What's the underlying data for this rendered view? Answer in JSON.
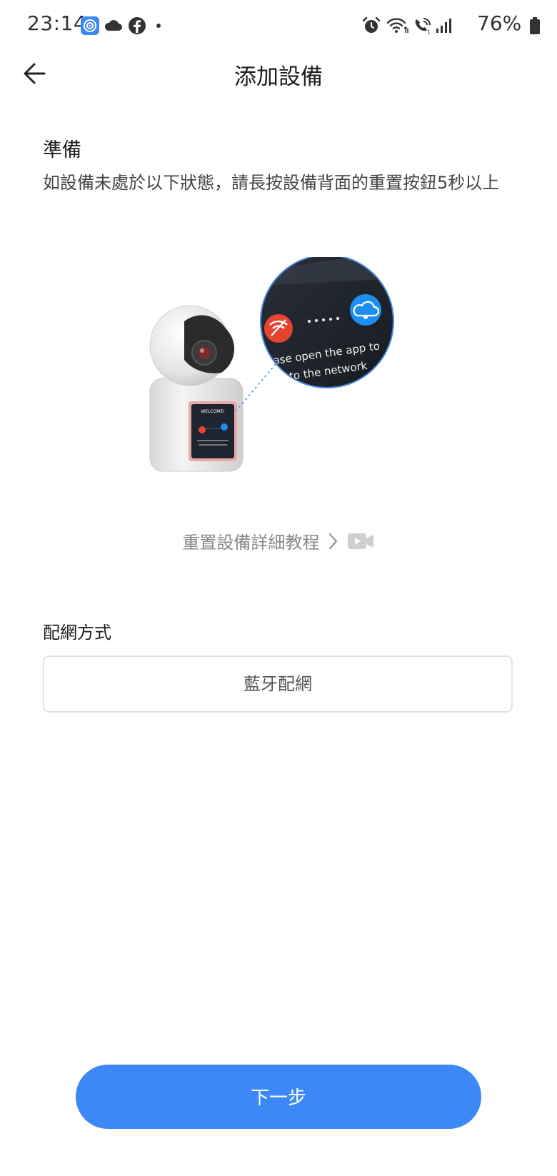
{
  "status_bar": {
    "time": "23:14",
    "battery": "76%",
    "left_icons": [
      "app-icon",
      "cloud-icon",
      "facebook-icon",
      "dot-icon"
    ],
    "right_icons": [
      "alarm-icon",
      "wifi-icon",
      "wifi-calling-icon",
      "signal-icon",
      "battery-icon"
    ]
  },
  "header": {
    "title": "添加設備",
    "back_icon": "back-arrow-icon"
  },
  "preparation": {
    "heading": "準備",
    "description": "如設備未處於以下狀態，請長按設備背面的重置按鈕5秒以上"
  },
  "illustration": {
    "screen_text_line1": "lease open the app to",
    "screen_text_line2": "ect to the network",
    "device_label": "WELCOME!"
  },
  "tutorial_link": {
    "label": "重置設備詳細教程",
    "icons": [
      "chevron-right-icon",
      "video-icon"
    ]
  },
  "network_method": {
    "label": "配網方式",
    "selected_value": "藍牙配網"
  },
  "footer": {
    "next_label": "下一步"
  },
  "colors": {
    "accent": "#3d88f7",
    "wifi_off_red": "#e5452f",
    "cloud_blue": "#1f8ef1",
    "muted_text": "#8a8a8a"
  }
}
